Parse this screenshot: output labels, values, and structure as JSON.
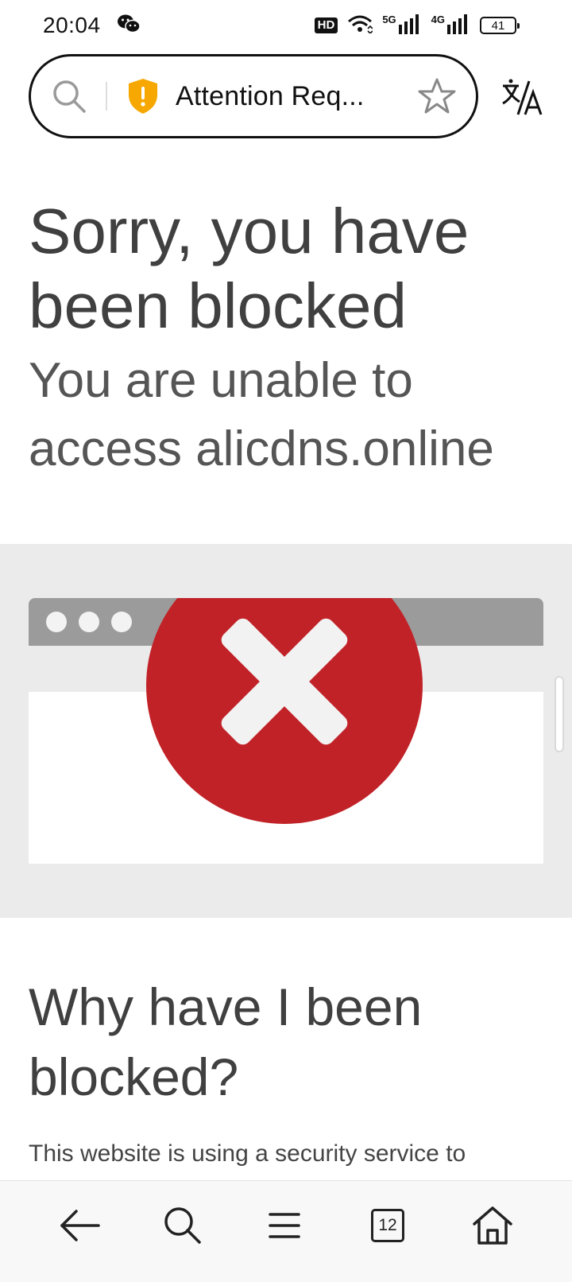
{
  "status_bar": {
    "time": "20:04",
    "hd_label": "HD",
    "network_5g": "5G",
    "network_4g": "4G",
    "battery": "41"
  },
  "browser": {
    "page_title": "Attention Req...",
    "tab_count": "12"
  },
  "page": {
    "heading": "Sorry, you have been blocked",
    "subheading": "You are unable to access alicdns.online",
    "why_heading": "Why have I been blocked?",
    "why_body": "This website is using a security service to"
  },
  "colors": {
    "block_red": "#c12227",
    "shield_yellow": "#f6a800",
    "chrome_gray": "#9b9b9b",
    "band_gray": "#ebebeb"
  },
  "icons": {
    "url_search": "search-icon",
    "security": "shield-warning-icon",
    "bookmark": "star-icon",
    "translate": "translate-icon",
    "back": "arrow-left-icon",
    "search": "search-icon",
    "menu": "menu-icon",
    "tabs": "tabs-icon",
    "home": "home-icon"
  }
}
